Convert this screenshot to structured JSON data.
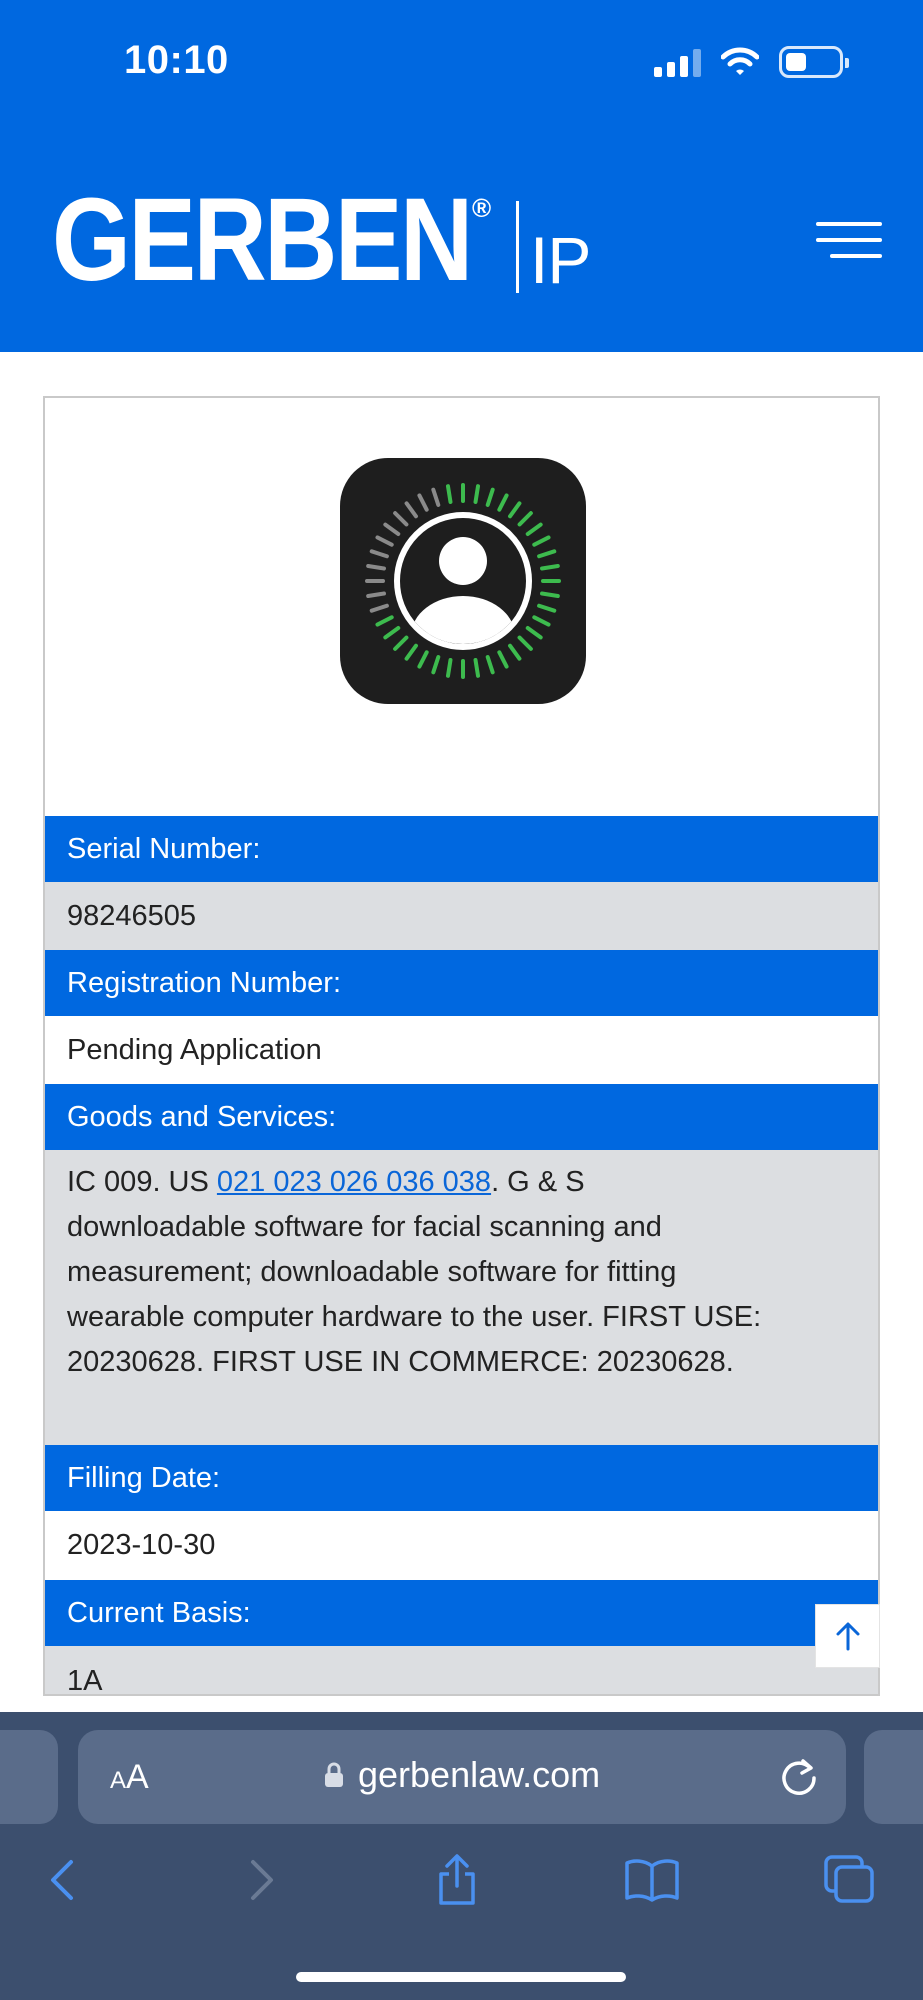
{
  "status_bar": {
    "time": "10:10"
  },
  "header": {
    "logo_main": "GERBEN",
    "logo_reg": "®",
    "logo_sub": "IP"
  },
  "colors": {
    "brand_blue": "#0068e0",
    "row_gray": "#dcdee1",
    "link_blue": "#0a66d8",
    "browser_bar": "#3c4f6e"
  },
  "trademark": {
    "image_icon": "face-scan-app-icon",
    "fields": {
      "serial_label": "Serial Number:",
      "serial_value": "98246505",
      "registration_label": "Registration Number:",
      "registration_value": "Pending Application",
      "goods_label": "Goods and Services:",
      "goods_prefix": "IC 009. US ",
      "goods_link": "021 023 026 036 038",
      "goods_text": ". G & S downloadable software for facial scanning and measurement; downloadable software for fitting wearable computer hardware to the user. FIRST USE: 20230628. FIRST USE IN COMMERCE: 20230628.",
      "filing_label": "Filling Date:",
      "filing_value": "2023-10-30",
      "basis_label": "Current Basis:",
      "basis_value": "1A"
    }
  },
  "browser": {
    "text_size_small": "A",
    "text_size_large": "A",
    "domain": "gerbenlaw.com",
    "icons": [
      "back-icon",
      "forward-icon",
      "share-icon",
      "bookmarks-icon",
      "tabs-icon",
      "reload-icon",
      "lock-icon"
    ]
  }
}
